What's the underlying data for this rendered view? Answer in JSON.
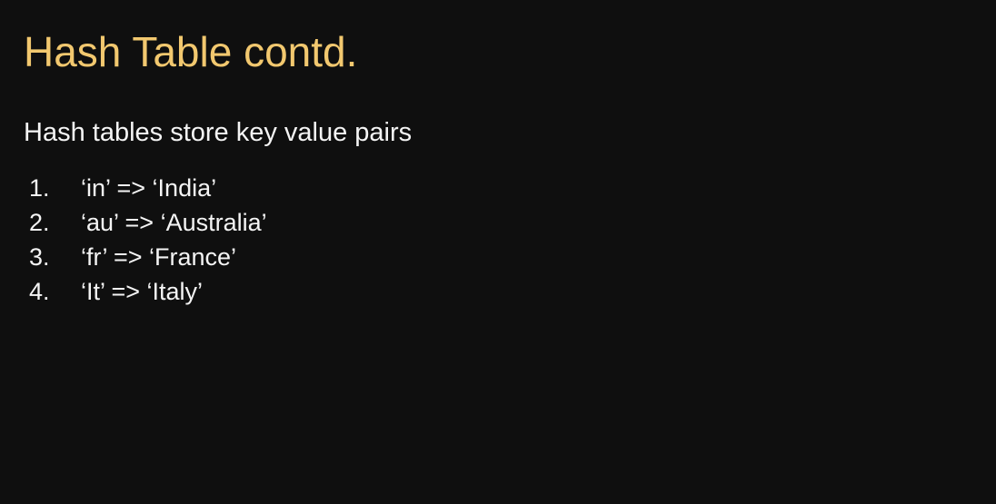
{
  "slide": {
    "title": "Hash Table contd.",
    "intro": "Hash tables store key value pairs",
    "items": [
      {
        "number": "1.",
        "text": "‘in’ => ‘India’"
      },
      {
        "number": "2.",
        "text": "‘au’ => ‘Australia’"
      },
      {
        "number": "3.",
        "text": "‘fr’ => ‘France’"
      },
      {
        "number": "4.",
        "text": "‘It’ => ‘Italy’"
      }
    ]
  },
  "colors": {
    "background": "#0f0f0f",
    "title": "#f2c86f",
    "body_text": "#f4f4f4"
  }
}
